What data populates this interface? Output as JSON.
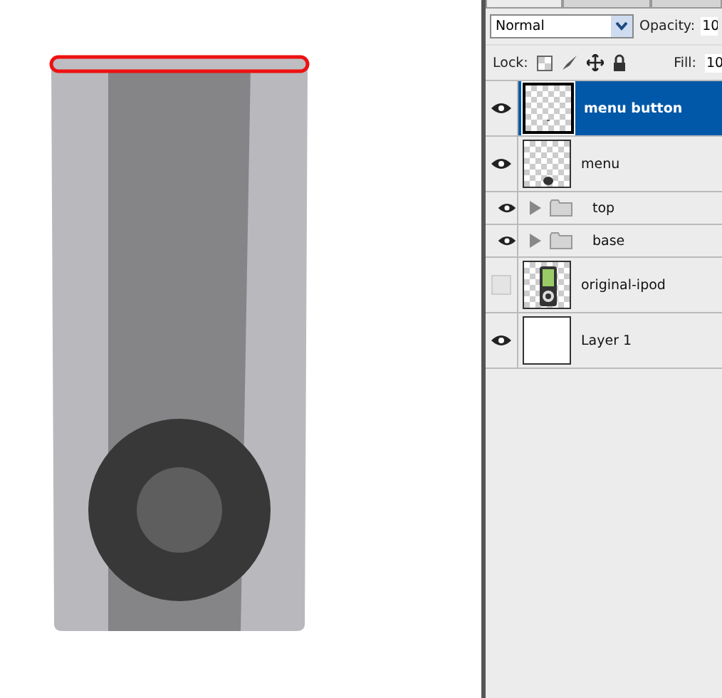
{
  "blend_mode": "Normal",
  "opacity_label": "Opacity:",
  "opacity_value": "10",
  "lock_label": "Lock:",
  "fill_label": "Fill:",
  "fill_value": "10",
  "layers": [
    {
      "kind": "small-dot",
      "name": "menu button",
      "visible": true,
      "selected": true
    },
    {
      "kind": "dot",
      "name": "menu",
      "visible": true,
      "selected": false
    },
    {
      "kind": "group",
      "name": "top",
      "expanded": false,
      "visible": true,
      "selected": false
    },
    {
      "kind": "group",
      "name": "base",
      "expanded": false,
      "visible": true,
      "selected": false
    },
    {
      "kind": "device",
      "name": "original-ipod",
      "visible": false,
      "selected": false
    },
    {
      "kind": "white",
      "name": "Layer 1",
      "visible": true,
      "selected": false
    }
  ]
}
